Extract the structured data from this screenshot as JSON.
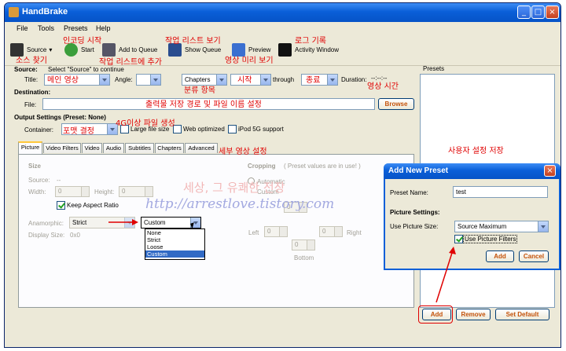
{
  "window": {
    "title": "HandBrake"
  },
  "menu": [
    "File",
    "Tools",
    "Presets",
    "Help"
  ],
  "toolbar": {
    "source": "Source",
    "start": "Start",
    "add_to_queue": "Add to Queue",
    "show_queue": "Show Queue",
    "preview": "Preview",
    "activity": "Activity Window"
  },
  "annotations": {
    "source_find": "소스 찾기",
    "encode_start": "인코딩 시작",
    "add_job": "작업 리스트에 추가",
    "view_jobs": "작업 리스트 보기",
    "preview_video": "영상 미리 보기",
    "log": "로그 기록",
    "main_video": "메인 영상",
    "category": "분류 항목",
    "start": "시작",
    "end": "종료",
    "video_time": "영상 시간",
    "output_path": "출력물 저장 경로 및 파일 이름 설정",
    "format": "포맷 결정",
    "over_4g": "4G이상 파일 생성",
    "detail_settings": "세부 영상 설정",
    "user_settings": "사용자 설정 저장",
    "watermark_1": "세상, 그 유쾌한 전장",
    "watermark_2": "http://arrestlove.tistory.com"
  },
  "source": {
    "heading": "Source:",
    "hint": "Select \"Source\" to continue",
    "title_label": "Title:",
    "angle_label": "Angle:",
    "chapters": "Chapters",
    "through": "through",
    "duration_label": "Duration:",
    "duration_value": "--:--:--"
  },
  "destination": {
    "heading": "Destination:",
    "file_label": "File:",
    "browse": "Browse"
  },
  "output": {
    "heading": "Output Settings (Preset: None)",
    "container_label": "Container:",
    "large_file": "Large file size",
    "web_optimized": "Web optimized",
    "ipod": "iPod 5G support"
  },
  "tabs": [
    "Picture",
    "Video Filters",
    "Video",
    "Audio",
    "Subtitles",
    "Chapters",
    "Advanced"
  ],
  "picture": {
    "size_heading": "Size",
    "source_label": "Source:",
    "source_value": "--",
    "width_label": "Width:",
    "height_label": "Height:",
    "width_value": "0",
    "height_value": "0",
    "keep_aspect": "Keep Aspect Ratio",
    "anamorphic_label": "Anamorphic:",
    "anamorphic_value": "Strict",
    "display_size_label": "Display Size:",
    "display_size_value": "0x0",
    "cropping_heading": "Cropping",
    "cropping_note": "( Preset values are in use! )",
    "automatic": "Automatic",
    "custom": "Custom",
    "left": "Left",
    "right": "Right",
    "bottom": "Bottom",
    "crop_value": "0"
  },
  "dropdown": {
    "selected": "Custom",
    "options": [
      "None",
      "Strict",
      "Loose",
      "Custom"
    ]
  },
  "presets": {
    "heading": "Presets",
    "add": "Add",
    "remove": "Remove",
    "set_default": "Set Default"
  },
  "dialog": {
    "title": "Add New Preset",
    "preset_name_label": "Preset Name:",
    "preset_name_value": "test",
    "picture_settings": "Picture Settings:",
    "use_picture_size_label": "Use Picture Size:",
    "use_picture_size_value": "Source Maximum",
    "use_filters": "Use Picture Filters",
    "add": "Add",
    "cancel": "Cancel"
  },
  "colors": {
    "annotation": "#e00000",
    "titlebar": "#0a5fd8"
  }
}
